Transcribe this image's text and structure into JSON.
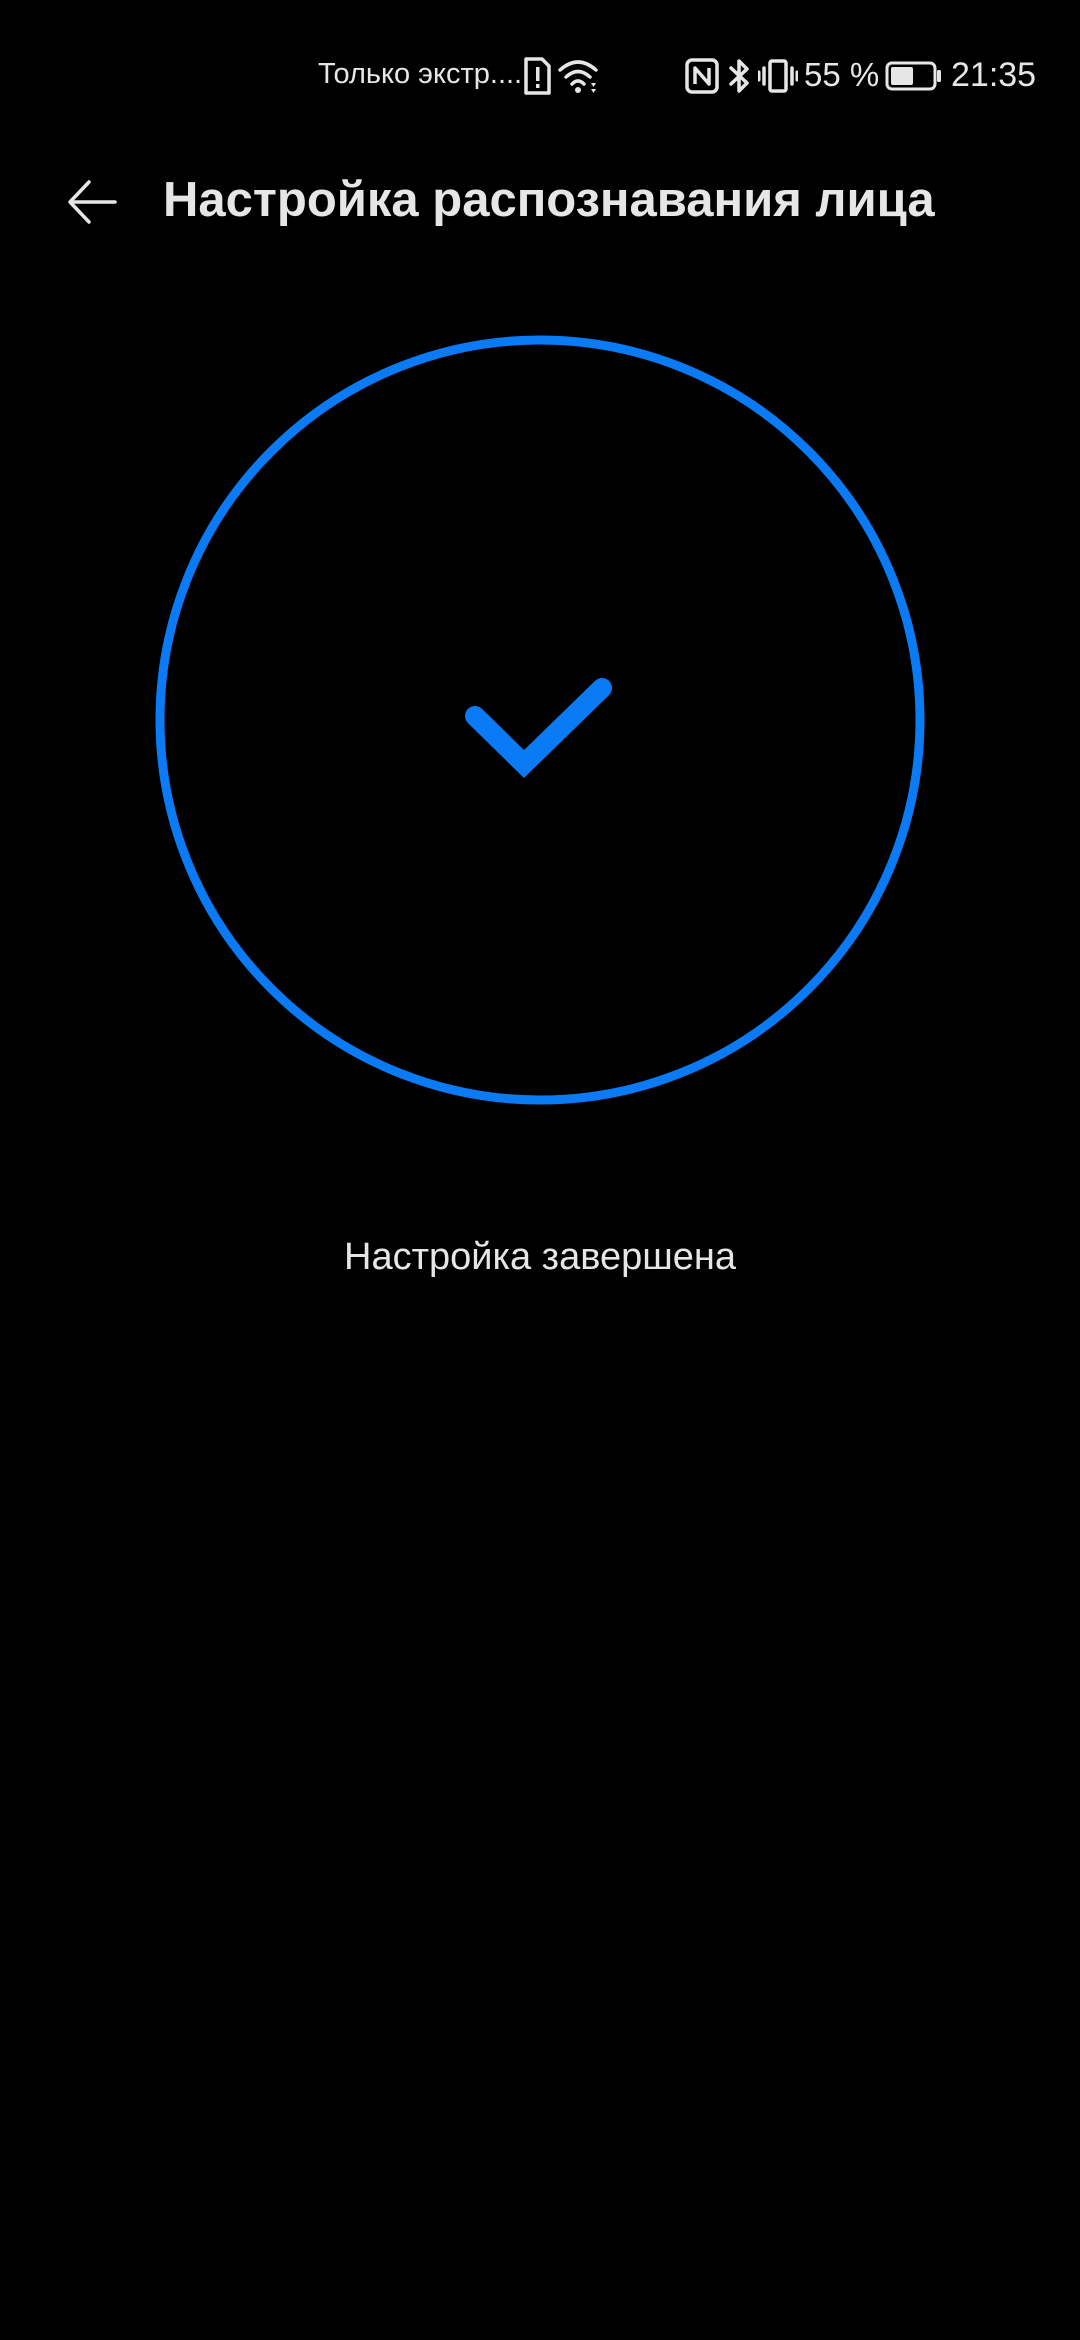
{
  "status_bar": {
    "carrier": "Только экстр....",
    "battery_percent": "55 %",
    "time": "21:35",
    "icons": [
      "sim-alert-icon",
      "wifi-icon",
      "nfc-icon",
      "bluetooth-icon",
      "vibrate-icon",
      "battery-icon"
    ],
    "battery_level": 0.55
  },
  "app_bar": {
    "back_icon": "arrow-left-icon",
    "title": "Настройка распознавания лица"
  },
  "main": {
    "success_icon": "checkmark-icon",
    "status_message": "Настройка завершена"
  },
  "colors": {
    "accent": "#0A7BF5",
    "background": "#000000",
    "text": "#E6E6E6"
  }
}
